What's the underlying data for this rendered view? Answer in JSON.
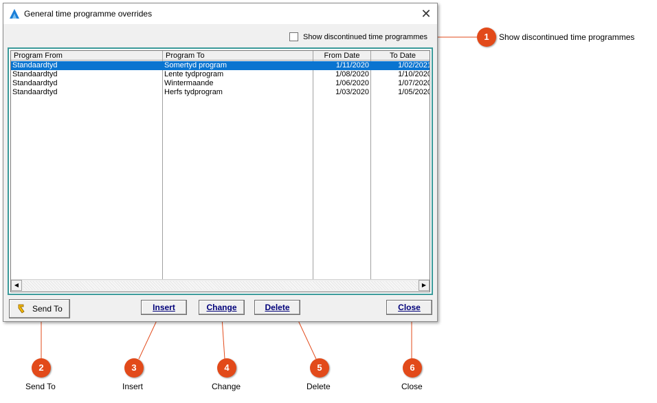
{
  "window": {
    "title": "General time programme overrides",
    "close_glyph": "✕"
  },
  "options": {
    "show_discontinued_label": "Show discontinued time programmes",
    "show_discontinued_checked": false
  },
  "table": {
    "columns": [
      "Program From",
      "Program To",
      "From Date",
      "To Date"
    ],
    "rows": [
      {
        "program_from": "Standaardtyd",
        "program_to": "Somertyd program",
        "from_date": "1/11/2020",
        "to_date": "1/02/2021",
        "selected": true
      },
      {
        "program_from": "Standaardtyd",
        "program_to": "Lente tydprogram",
        "from_date": "1/08/2020",
        "to_date": "1/10/2020",
        "selected": false
      },
      {
        "program_from": "Standaardtyd",
        "program_to": "Wintermaande",
        "from_date": "1/06/2020",
        "to_date": "1/07/2020",
        "selected": false
      },
      {
        "program_from": "Standaardtyd",
        "program_to": "Herfs tydprogram",
        "from_date": "1/03/2020",
        "to_date": "1/05/2020",
        "selected": false
      }
    ],
    "selection_color": "#0a74d0"
  },
  "buttons": {
    "send_to": "Send To",
    "insert": "Insert",
    "change": "Change",
    "delete": "Delete",
    "close": "Close"
  },
  "callouts": [
    {
      "number": "1",
      "label": "Show discontinued time programmes"
    },
    {
      "number": "2",
      "label": "Send To"
    },
    {
      "number": "3",
      "label": "Insert"
    },
    {
      "number": "4",
      "label": "Change"
    },
    {
      "number": "5",
      "label": "Delete"
    },
    {
      "number": "6",
      "label": "Close"
    }
  ],
  "colors": {
    "callout": "#e24a1a",
    "grid_border": "#3a9a9a",
    "button_text": "#00007a"
  }
}
